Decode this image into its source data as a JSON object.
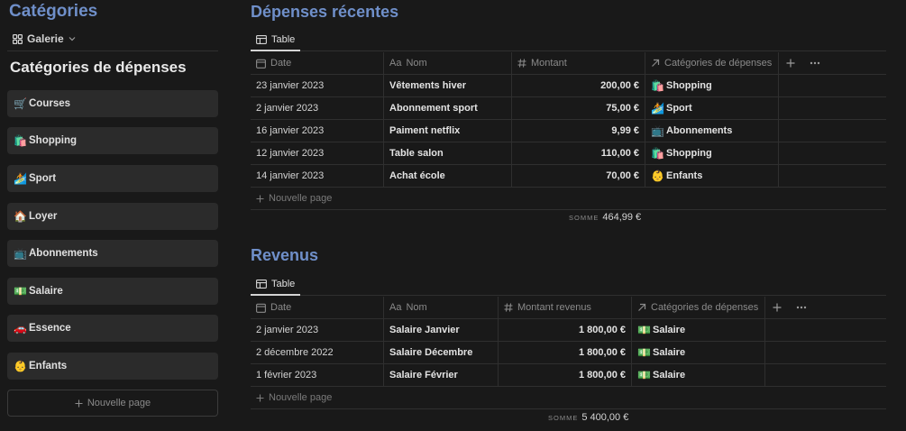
{
  "left": {
    "title": "Catégories",
    "view": "Galerie",
    "heading": "Catégories de dépenses",
    "cards": [
      {
        "emoji": "🛒",
        "label": "Courses"
      },
      {
        "emoji": "🛍️",
        "label": "Shopping"
      },
      {
        "emoji": "🏄",
        "label": "Sport"
      },
      {
        "emoji": "🏠",
        "label": "Loyer"
      },
      {
        "emoji": "📺",
        "label": "Abonnements"
      },
      {
        "emoji": "💵",
        "label": "Salaire"
      },
      {
        "emoji": "🚗",
        "label": "Essence"
      },
      {
        "emoji": "👶",
        "label": "Enfants"
      }
    ],
    "new_page": "Nouvelle page"
  },
  "expenses": {
    "title": "Dépenses récentes",
    "tab": "Table",
    "headers": {
      "date": "Date",
      "name": "Nom",
      "amount": "Montant",
      "category": "Catégories de dépenses"
    },
    "name_prefix": "Aa",
    "rows": [
      {
        "date": "23 janvier 2023",
        "name": "Vêtements hiver",
        "amount": "200,00 €",
        "cat_emoji": "🛍️",
        "cat": "Shopping"
      },
      {
        "date": "2 janvier 2023",
        "name": "Abonnement sport",
        "amount": "75,00 €",
        "cat_emoji": "🏄",
        "cat": "Sport"
      },
      {
        "date": "16 janvier 2023",
        "name": "Paiment netflix",
        "amount": "9,99 €",
        "cat_emoji": "📺",
        "cat": "Abonnements"
      },
      {
        "date": "12 janvier 2023",
        "name": "Table salon",
        "amount": "110,00 €",
        "cat_emoji": "🛍️",
        "cat": "Shopping"
      },
      {
        "date": "14 janvier 2023",
        "name": "Achat école",
        "amount": "70,00 €",
        "cat_emoji": "👶",
        "cat": "Enfants"
      }
    ],
    "new_page": "Nouvelle page",
    "sum_label": "SOMME",
    "sum_value": "464,99 €"
  },
  "income": {
    "title": "Revenus",
    "tab": "Table",
    "headers": {
      "date": "Date",
      "name": "Nom",
      "amount": "Montant revenus",
      "category": "Catégories de dépenses"
    },
    "name_prefix": "Aa",
    "rows": [
      {
        "date": "2 janvier 2023",
        "name": "Salaire Janvier",
        "amount": "1 800,00 €",
        "cat_emoji": "💵",
        "cat": "Salaire"
      },
      {
        "date": "2 décembre 2022",
        "name": "Salaire Décembre",
        "amount": "1 800,00 €",
        "cat_emoji": "💵",
        "cat": "Salaire"
      },
      {
        "date": "1 février 2023",
        "name": "Salaire Février",
        "amount": "1 800,00 €",
        "cat_emoji": "💵",
        "cat": "Salaire"
      }
    ],
    "new_page": "Nouvelle page",
    "sum_label": "SOMME",
    "sum_value": "5 400,00 €"
  },
  "colors": {
    "background": "#191919",
    "accent": "#6f8fc9",
    "card": "#2b2b2b",
    "border": "#2f2f2f"
  }
}
